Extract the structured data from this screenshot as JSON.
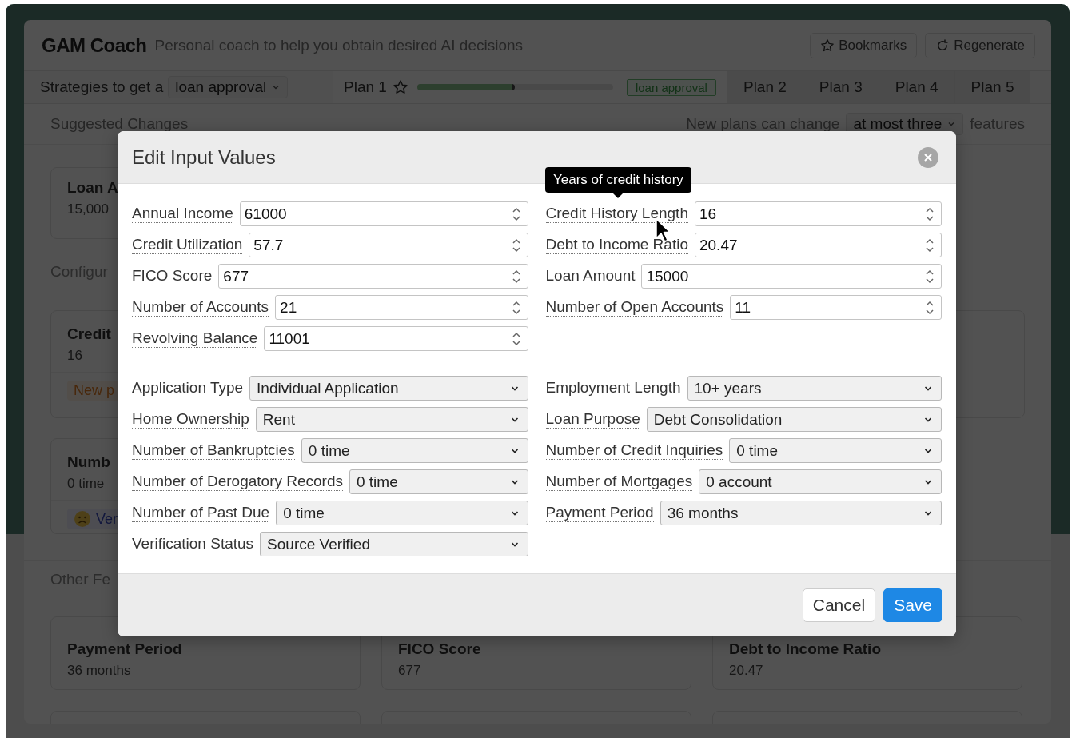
{
  "app": {
    "logo": "GAM Coach",
    "subtitle": "Personal coach to help you obtain desired AI decisions",
    "buttons": [
      {
        "label": "Bookmarks",
        "kind": "bookmarks"
      },
      {
        "label": "Regenerate",
        "kind": "regenerate"
      }
    ]
  },
  "strategy_bar": {
    "prefix": "Strategies to get a",
    "decision": "loan approval",
    "plans": [
      {
        "label": "Plan 1",
        "selected": true,
        "level": 0.5,
        "badge": "loan approval"
      },
      {
        "label": "Plan 2",
        "selected": false
      },
      {
        "label": "Plan 3",
        "selected": false
      },
      {
        "label": "Plan 4",
        "selected": false
      },
      {
        "label": "Plan 5",
        "selected": false
      }
    ]
  },
  "suggested": {
    "title": "Suggested Changes",
    "prefix": "New plans can change",
    "limit": "at most three",
    "suffix": "features",
    "cards": [
      {
        "title": "Loan A",
        "value": "15,000"
      }
    ]
  },
  "configured": {
    "title": "Configur",
    "cards": [
      {
        "title": "Credit",
        "value": "16",
        "kind": "new",
        "tag": "New p"
      },
      {
        "title": "Numb",
        "value": "0 time",
        "kind": "feedback",
        "tag": "Ver"
      }
    ]
  },
  "other": {
    "title": "Other Fe",
    "cards": [
      {
        "title": "Payment Period",
        "value": "36 months"
      },
      {
        "title": "FICO Score",
        "value": "677"
      },
      {
        "title": "Debt to Income Ratio",
        "value": "20.47"
      }
    ]
  },
  "dialog": {
    "title": "Edit Input Values",
    "numeric_fields": {
      "left": [
        {
          "label": "Annual Income",
          "value": "61000"
        },
        {
          "label": "Credit Utilization",
          "value": "57.7"
        },
        {
          "label": "FICO Score",
          "value": "677"
        },
        {
          "label": "Number of Accounts",
          "value": "21"
        },
        {
          "label": "Revolving Balance",
          "value": "11001"
        }
      ],
      "right": [
        {
          "label": "Credit History Length",
          "value": "16"
        },
        {
          "label": "Debt to Income Ratio",
          "value": "20.47"
        },
        {
          "label": "Loan Amount",
          "value": "15000"
        },
        {
          "label": "Number of Open Accounts",
          "value": "11"
        }
      ]
    },
    "select_fields": {
      "left": [
        {
          "label": "Application Type",
          "value": "Individual Application"
        },
        {
          "label": "Home Ownership",
          "value": "Rent"
        },
        {
          "label": "Number of Bankruptcies",
          "value": "0 time"
        },
        {
          "label": "Number of Derogatory Records",
          "value": "0 time"
        },
        {
          "label": "Number of Past Due",
          "value": "0 time"
        },
        {
          "label": "Verification Status",
          "value": "Source Verified"
        }
      ],
      "right": [
        {
          "label": "Employment Length",
          "value": "10+ years"
        },
        {
          "label": "Loan Purpose",
          "value": "Debt Consolidation"
        },
        {
          "label": "Number of Credit Inquiries",
          "value": "0 time"
        },
        {
          "label": "Number of Mortgages",
          "value": "0 account"
        },
        {
          "label": "Payment Period",
          "value": "36 months"
        }
      ]
    },
    "tooltip": "Years of credit history",
    "buttons": [
      {
        "label": "Cancel",
        "kind": "secondary"
      },
      {
        "label": "Save",
        "kind": "primary"
      }
    ]
  }
}
